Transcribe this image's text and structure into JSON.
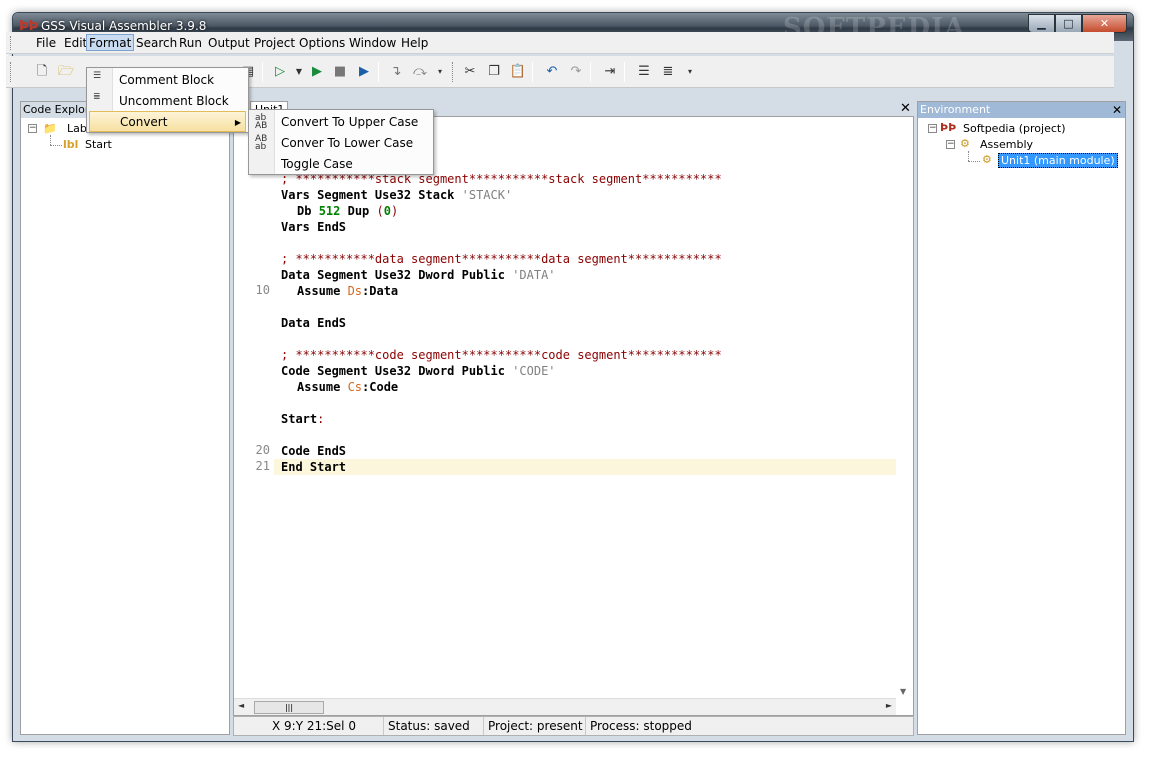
{
  "window": {
    "title": "GSS Visual Assembler 3.9.8",
    "watermark": "SOFTPEDIA",
    "min_glyph": "▁",
    "max_glyph": "□",
    "close_glyph": "✕"
  },
  "menubar": {
    "items": [
      {
        "label": "File"
      },
      {
        "label": "Edit"
      },
      {
        "label": "Format"
      },
      {
        "label": "Search"
      },
      {
        "label": "Run"
      },
      {
        "label": "Output"
      },
      {
        "label": "Project"
      },
      {
        "label": "Options"
      },
      {
        "label": "Window"
      },
      {
        "label": "Help"
      }
    ]
  },
  "format_menu": {
    "items": [
      {
        "label": "Comment Block",
        "icon": "comment-block-icon"
      },
      {
        "label": "Uncomment Block",
        "icon": "uncomment-block-icon"
      },
      {
        "label": "Convert",
        "icon": "convert-icon"
      }
    ]
  },
  "convert_menu": {
    "items": [
      {
        "label": "Convert To Upper Case",
        "icon": "upper-case-icon",
        "icon_text": "ab AB"
      },
      {
        "label": "Conver To Lower Case",
        "icon": "lower-case-icon",
        "icon_text": "AB ab"
      },
      {
        "label": "Toggle Case",
        "icon": "toggle-case-icon"
      }
    ]
  },
  "code_explorer": {
    "title": "Code Explore",
    "items": [
      {
        "label": "Lab",
        "icon": "folder-icon"
      },
      {
        "label": "Start",
        "icon": "label-icon",
        "icon_text": "lbl"
      }
    ]
  },
  "environment": {
    "title": "Environment",
    "close": "✕",
    "items": [
      {
        "label": "Softpedia (project)",
        "icon": "project-icon"
      },
      {
        "label": "Assembly",
        "icon": "assembly-icon"
      },
      {
        "label": "Unit1 (main module)",
        "icon": "module-icon",
        "selected": true
      }
    ]
  },
  "editor": {
    "tab_label": "Unit1",
    "close": "✕",
    "line_numbers": [
      "10",
      "20",
      "21"
    ]
  },
  "code": {
    "stack_comment": "; ***********stack segment***********stack segment***********",
    "vars_seg": "Vars Segment Use32 Stack ",
    "vars_seg_str": "'STACK'",
    "db": "Db ",
    "db_num": "512",
    "db_dup": " Dup ",
    "db_open": "(",
    "db_val": "0",
    "db_close": ")",
    "vars_ends": "Vars EndS",
    "data_comment": "; ***********data segment***********data segment*************",
    "data_seg": "Data Segment Use32 Dword Public ",
    "data_seg_str": "'DATA'",
    "assume_data": "Assume ",
    "assume_data_reg": "Ds",
    "assume_data_rest": ":Data",
    "data_ends": "Data EndS",
    "code_comment": "; ***********code segment***********code segment*************",
    "code_seg": "Code Segment Use32 Dword Public ",
    "code_seg_str": "'CODE'",
    "assume_code": "Assume ",
    "assume_code_reg": "Cs",
    "assume_code_rest": ":Code",
    "start_label": "Start",
    "start_colon": ":",
    "code_ends": "Code EndS",
    "end_start": "End Start"
  },
  "statusbar": {
    "position": "X 9:Y 21:Sel 0",
    "status": "Status: saved",
    "project": "Project: present",
    "process": "Process: stopped"
  },
  "colors": {
    "comment": "#8b0000",
    "string": "#808080",
    "number": "#008000",
    "register": "#d2691e",
    "highlight": "#fcf6dc",
    "selection": "#3399ff"
  }
}
